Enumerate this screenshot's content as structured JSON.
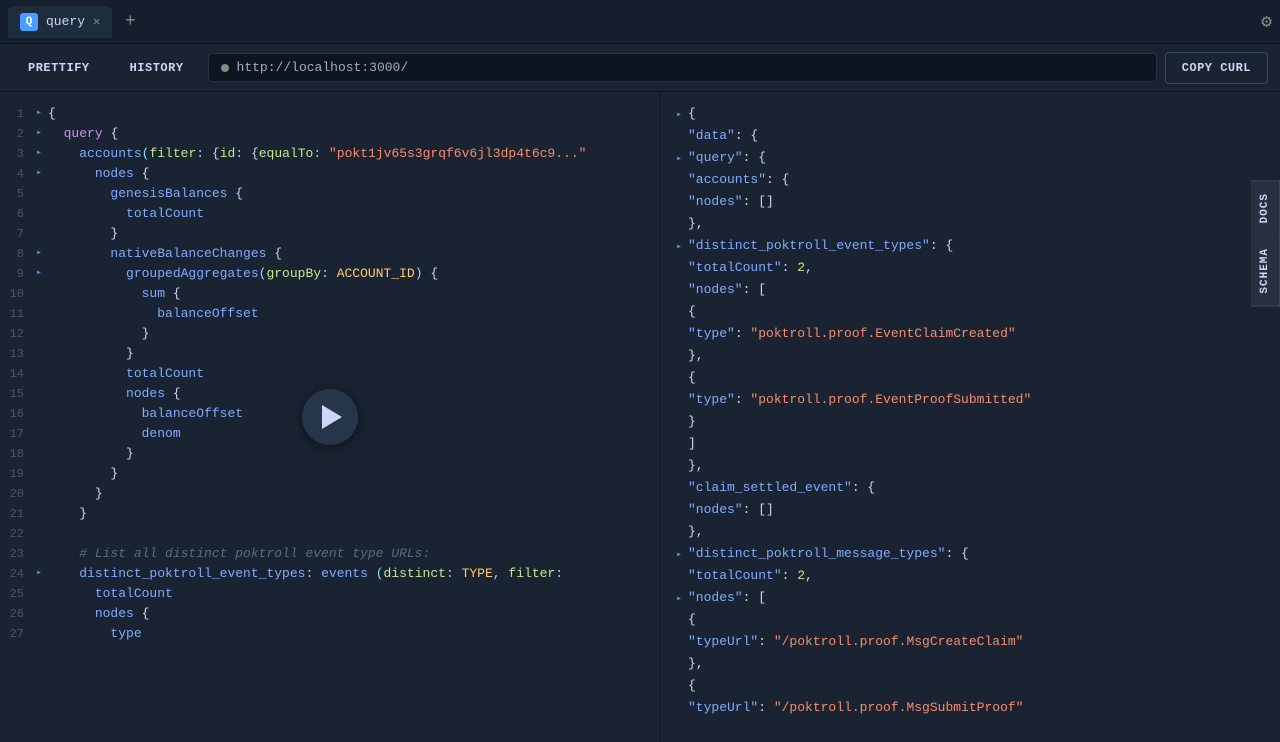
{
  "tabs": [
    {
      "id": "query",
      "label": "query",
      "icon": "Q",
      "active": true
    }
  ],
  "toolbar": {
    "prettify_label": "PRETTIFY",
    "history_label": "HISTORY",
    "url": "http://localhost:3000/",
    "copy_curl_label": "COPY CURL"
  },
  "side_tabs": [
    {
      "label": "DOCS"
    },
    {
      "label": "SCHEMA"
    }
  ],
  "editor": {
    "lines": [
      {
        "num": 1,
        "indent": 0,
        "arrow": "▸",
        "content": "{"
      },
      {
        "num": 2,
        "indent": 0,
        "arrow": "▸",
        "content": "  query {"
      },
      {
        "num": 3,
        "indent": 0,
        "arrow": "▸",
        "content": "    accounts(filter: {id: {equalTo: \"pokt1jv65s3grqf6v6jl3dp4t6c9..."
      },
      {
        "num": 4,
        "indent": 0,
        "arrow": "▸",
        "content": "      nodes {"
      },
      {
        "num": 5,
        "indent": 0,
        "arrow": "",
        "content": "        genesisBalances {"
      },
      {
        "num": 6,
        "indent": 0,
        "arrow": "",
        "content": "          totalCount"
      },
      {
        "num": 7,
        "indent": 0,
        "arrow": "",
        "content": "        }"
      },
      {
        "num": 8,
        "indent": 0,
        "arrow": "▸",
        "content": "        nativeBalanceChanges {"
      },
      {
        "num": 9,
        "indent": 0,
        "arrow": "▸",
        "content": "          groupedAggregates(groupBy: ACCOUNT_ID) {"
      },
      {
        "num": 10,
        "indent": 0,
        "arrow": "",
        "content": "            sum {"
      },
      {
        "num": 11,
        "indent": 0,
        "arrow": "",
        "content": "              balanceOffset"
      },
      {
        "num": 12,
        "indent": 0,
        "arrow": "",
        "content": "            }"
      },
      {
        "num": 13,
        "indent": 0,
        "arrow": "",
        "content": "          }"
      },
      {
        "num": 14,
        "indent": 0,
        "arrow": "",
        "content": "          totalCount"
      },
      {
        "num": 15,
        "indent": 0,
        "arrow": "",
        "content": "          nodes {"
      },
      {
        "num": 16,
        "indent": 0,
        "arrow": "",
        "content": "            balanceOffset"
      },
      {
        "num": 17,
        "indent": 0,
        "arrow": "",
        "content": "            denom"
      },
      {
        "num": 18,
        "indent": 0,
        "arrow": "",
        "content": "          }"
      },
      {
        "num": 19,
        "indent": 0,
        "arrow": "",
        "content": "        }"
      },
      {
        "num": 20,
        "indent": 0,
        "arrow": "",
        "content": "      }"
      },
      {
        "num": 21,
        "indent": 0,
        "arrow": "",
        "content": "    }"
      },
      {
        "num": 22,
        "indent": 0,
        "arrow": "",
        "content": ""
      },
      {
        "num": 23,
        "indent": 0,
        "arrow": "",
        "content": "    # List all distinct poktroll event type URLs:"
      },
      {
        "num": 24,
        "indent": 0,
        "arrow": "▸",
        "content": "    distinct_poktroll_event_types: events (distinct: TYPE, filter:"
      },
      {
        "num": 25,
        "indent": 0,
        "arrow": "",
        "content": "      totalCount"
      },
      {
        "num": 26,
        "indent": 0,
        "arrow": "",
        "content": "      nodes {"
      },
      {
        "num": 27,
        "indent": 0,
        "arrow": "",
        "content": "        type"
      }
    ]
  },
  "result": {
    "lines": [
      {
        "collapse": "▸",
        "text": "{"
      },
      {
        "collapse": "",
        "text": "  \"data\": {"
      },
      {
        "collapse": "▸",
        "text": "    \"query\": {"
      },
      {
        "collapse": "",
        "text": "      \"accounts\": {"
      },
      {
        "collapse": "",
        "text": "        \"nodes\": []"
      },
      {
        "collapse": "",
        "text": "      },"
      },
      {
        "collapse": "▸",
        "text": "      \"distinct_poktroll_event_types\": {"
      },
      {
        "collapse": "",
        "text": "        \"totalCount\": 2,"
      },
      {
        "collapse": "",
        "text": "        \"nodes\": ["
      },
      {
        "collapse": "",
        "text": "          {"
      },
      {
        "collapse": "",
        "text": "            \"type\": \"poktroll.proof.EventClaimCreated\""
      },
      {
        "collapse": "",
        "text": "          },"
      },
      {
        "collapse": "",
        "text": "          {"
      },
      {
        "collapse": "",
        "text": "            \"type\": \"poktroll.proof.EventProofSubmitted\""
      },
      {
        "collapse": "",
        "text": "          }"
      },
      {
        "collapse": "",
        "text": "        ]"
      },
      {
        "collapse": "",
        "text": "      },"
      },
      {
        "collapse": "",
        "text": "      \"claim_settled_event\": {"
      },
      {
        "collapse": "",
        "text": "        \"nodes\": []"
      },
      {
        "collapse": "",
        "text": "      },"
      },
      {
        "collapse": "▸",
        "text": "      \"distinct_poktroll_message_types\": {"
      },
      {
        "collapse": "",
        "text": "        \"totalCount\": 2,"
      },
      {
        "collapse": "▸",
        "text": "        \"nodes\": ["
      },
      {
        "collapse": "",
        "text": "          {"
      },
      {
        "collapse": "",
        "text": "            \"typeUrl\": \"/poktroll.proof.MsgCreateClaim\""
      },
      {
        "collapse": "",
        "text": "          },"
      },
      {
        "collapse": "",
        "text": "          {"
      },
      {
        "collapse": "",
        "text": "            \"typeUrl\": \"/poktroll.proof.MsgSubmitProof\""
      }
    ]
  }
}
